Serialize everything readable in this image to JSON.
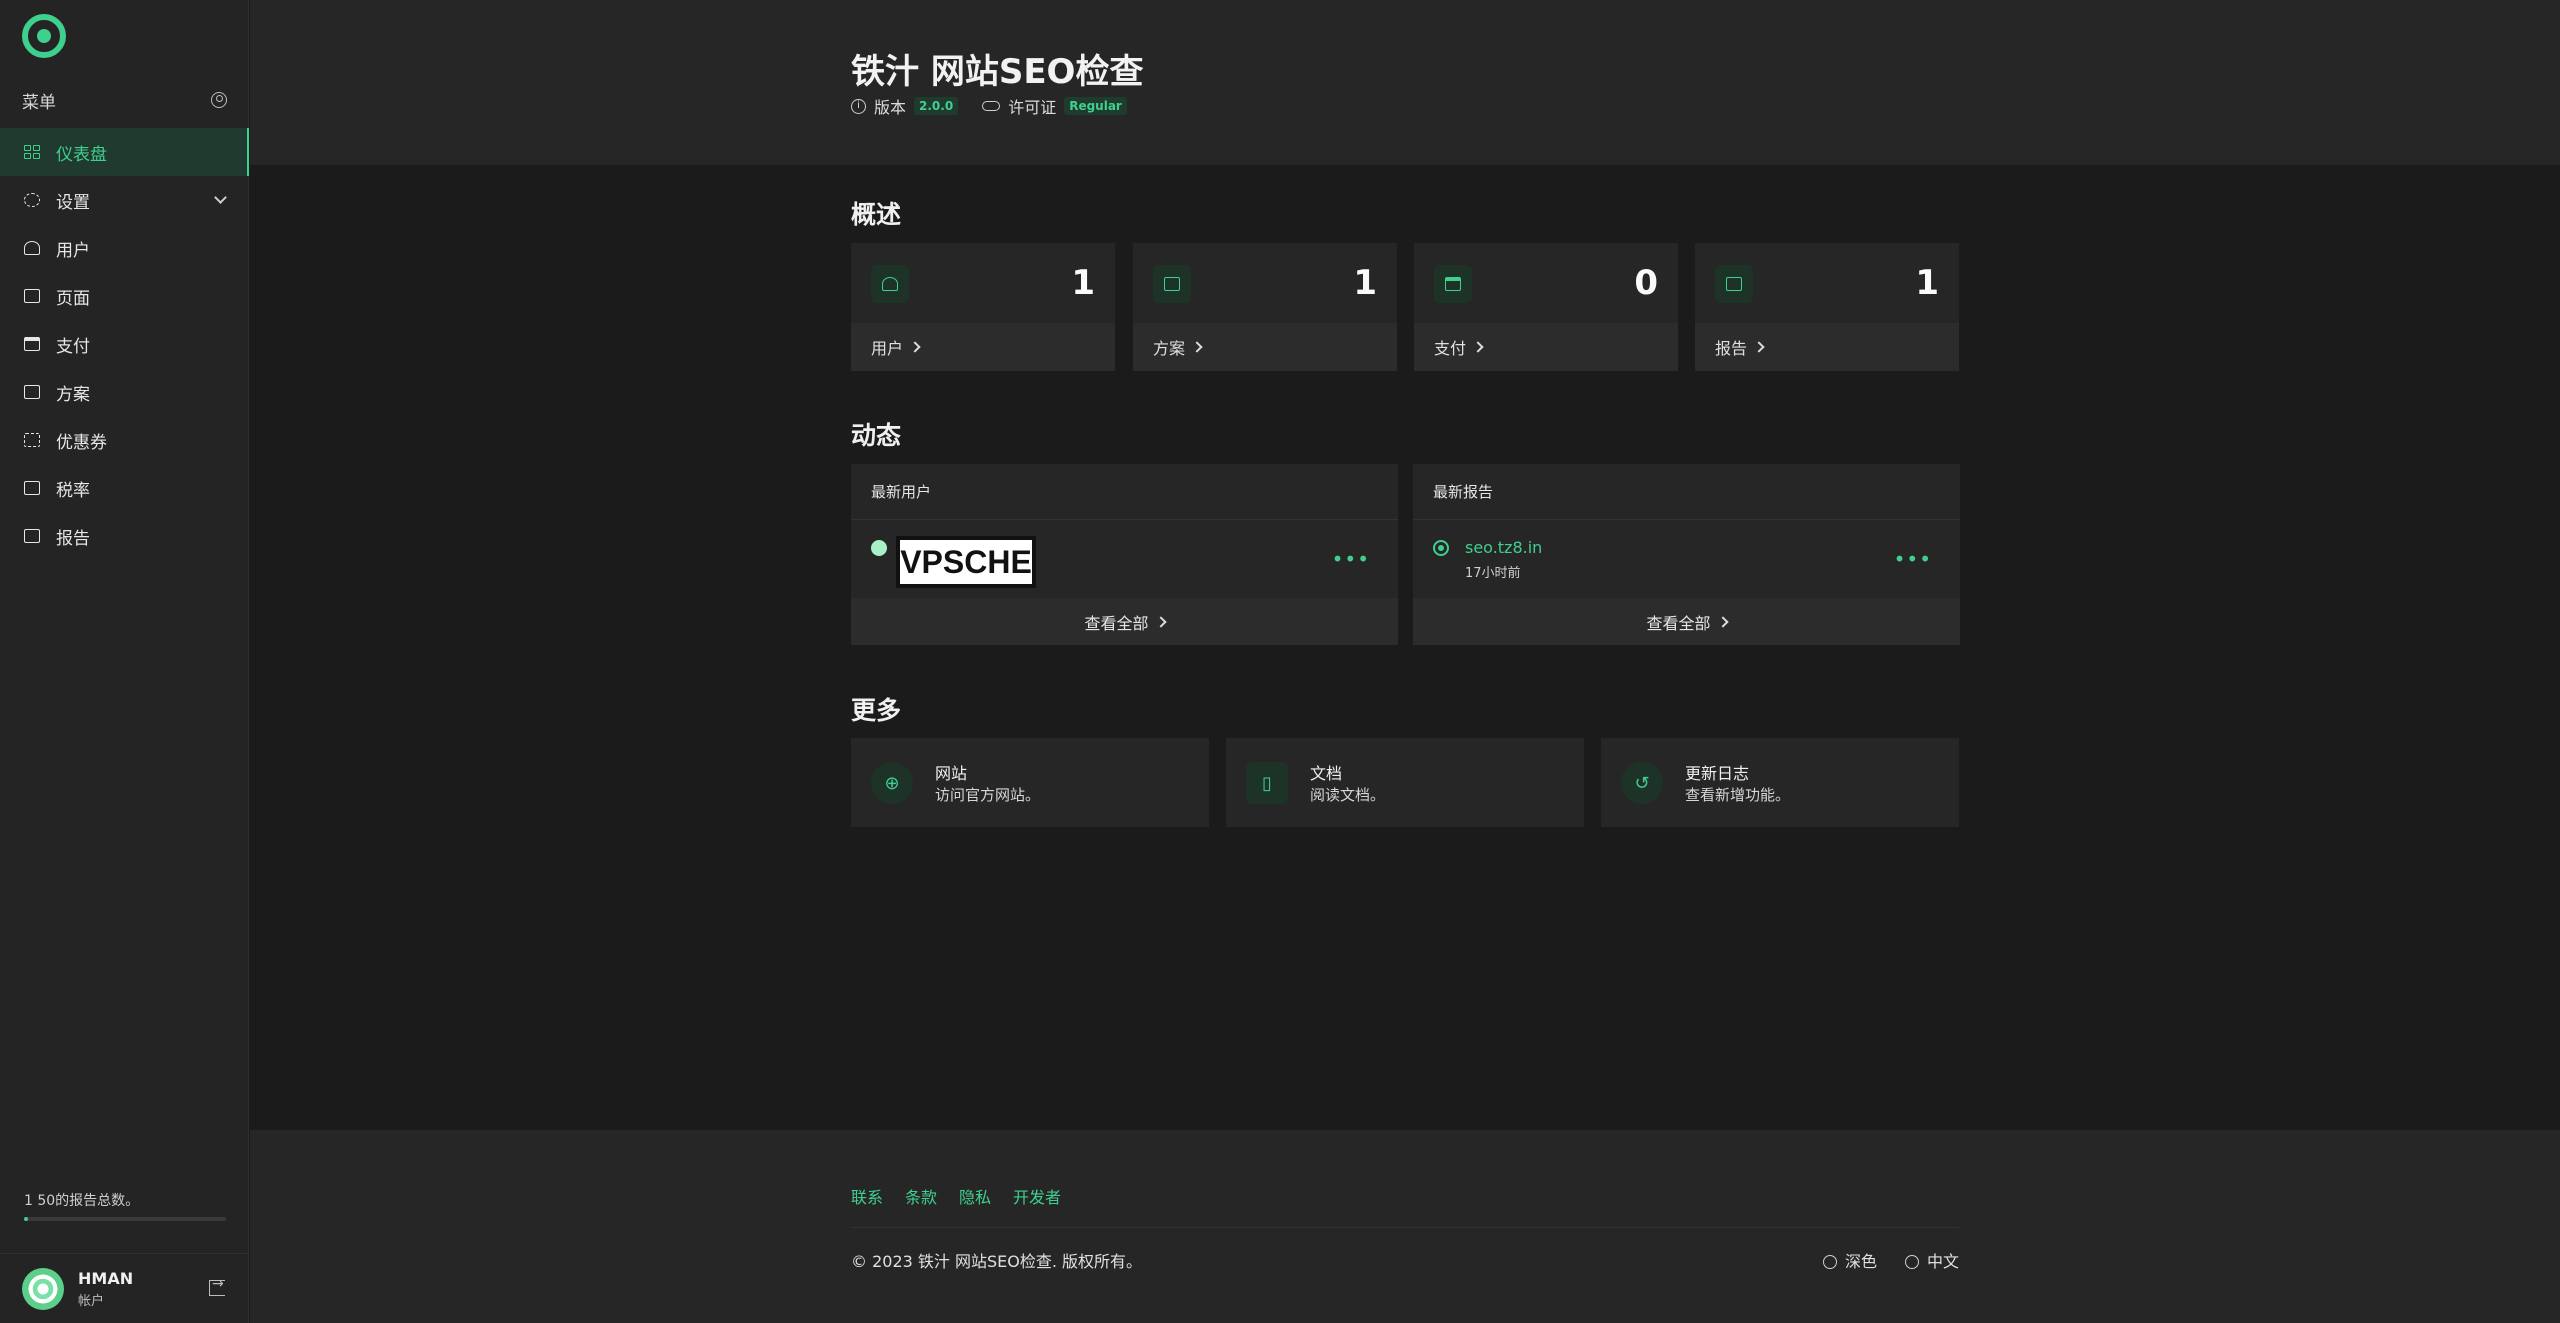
{
  "colors": {
    "accent": "#3fcf8e",
    "background": "#1b1b1b",
    "panel": "#262626"
  },
  "sidebar": {
    "menu_label": "菜单",
    "items": [
      {
        "label": "仪表盘",
        "icon": "dashboard-icon",
        "active": true
      },
      {
        "label": "设置",
        "icon": "gear-icon",
        "expandable": true
      },
      {
        "label": "用户",
        "icon": "users-icon"
      },
      {
        "label": "页面",
        "icon": "pages-icon"
      },
      {
        "label": "支付",
        "icon": "credit-card-icon"
      },
      {
        "label": "方案",
        "icon": "plan-icon"
      },
      {
        "label": "优惠券",
        "icon": "coupon-icon"
      },
      {
        "label": "税率",
        "icon": "tax-icon"
      },
      {
        "label": "报告",
        "icon": "report-icon"
      }
    ],
    "quota_text": "1 50的报告总数。",
    "quota_fraction": 0.02,
    "account": {
      "name": "HMAN",
      "role": "帐户"
    }
  },
  "header": {
    "title": "铁汁 网站SEO检查",
    "version_label": "版本",
    "version": "2.0.0",
    "license_label": "许可证",
    "license": "Regular"
  },
  "overview": {
    "title": "概述",
    "stats": [
      {
        "label": "用户",
        "value": "1",
        "icon": "users-icon"
      },
      {
        "label": "方案",
        "value": "1",
        "icon": "plan-icon"
      },
      {
        "label": "支付",
        "value": "0",
        "icon": "credit-card-icon"
      },
      {
        "label": "报告",
        "value": "1",
        "icon": "report-icon"
      }
    ]
  },
  "activity": {
    "title": "动态",
    "latest_users": {
      "title": "最新用户",
      "user_badge": "VPSCHE",
      "view_all": "查看全部"
    },
    "latest_reports": {
      "title": "最新报告",
      "link": "seo.tz8.in",
      "time": "17小时前",
      "view_all": "查看全部"
    }
  },
  "more": {
    "title": "更多",
    "items": [
      {
        "title": "网站",
        "desc": "访问官方网站。",
        "icon": "www-icon"
      },
      {
        "title": "文档",
        "desc": "阅读文档。",
        "icon": "book-icon"
      },
      {
        "title": "更新日志",
        "desc": "查看新增功能。",
        "icon": "history-icon"
      }
    ]
  },
  "footer": {
    "links": [
      "联系",
      "条款",
      "隐私",
      "开发者"
    ],
    "copyright": "© 2023 铁汁 网站SEO检查. 版权所有。",
    "theme": "深色",
    "language": "中文"
  }
}
